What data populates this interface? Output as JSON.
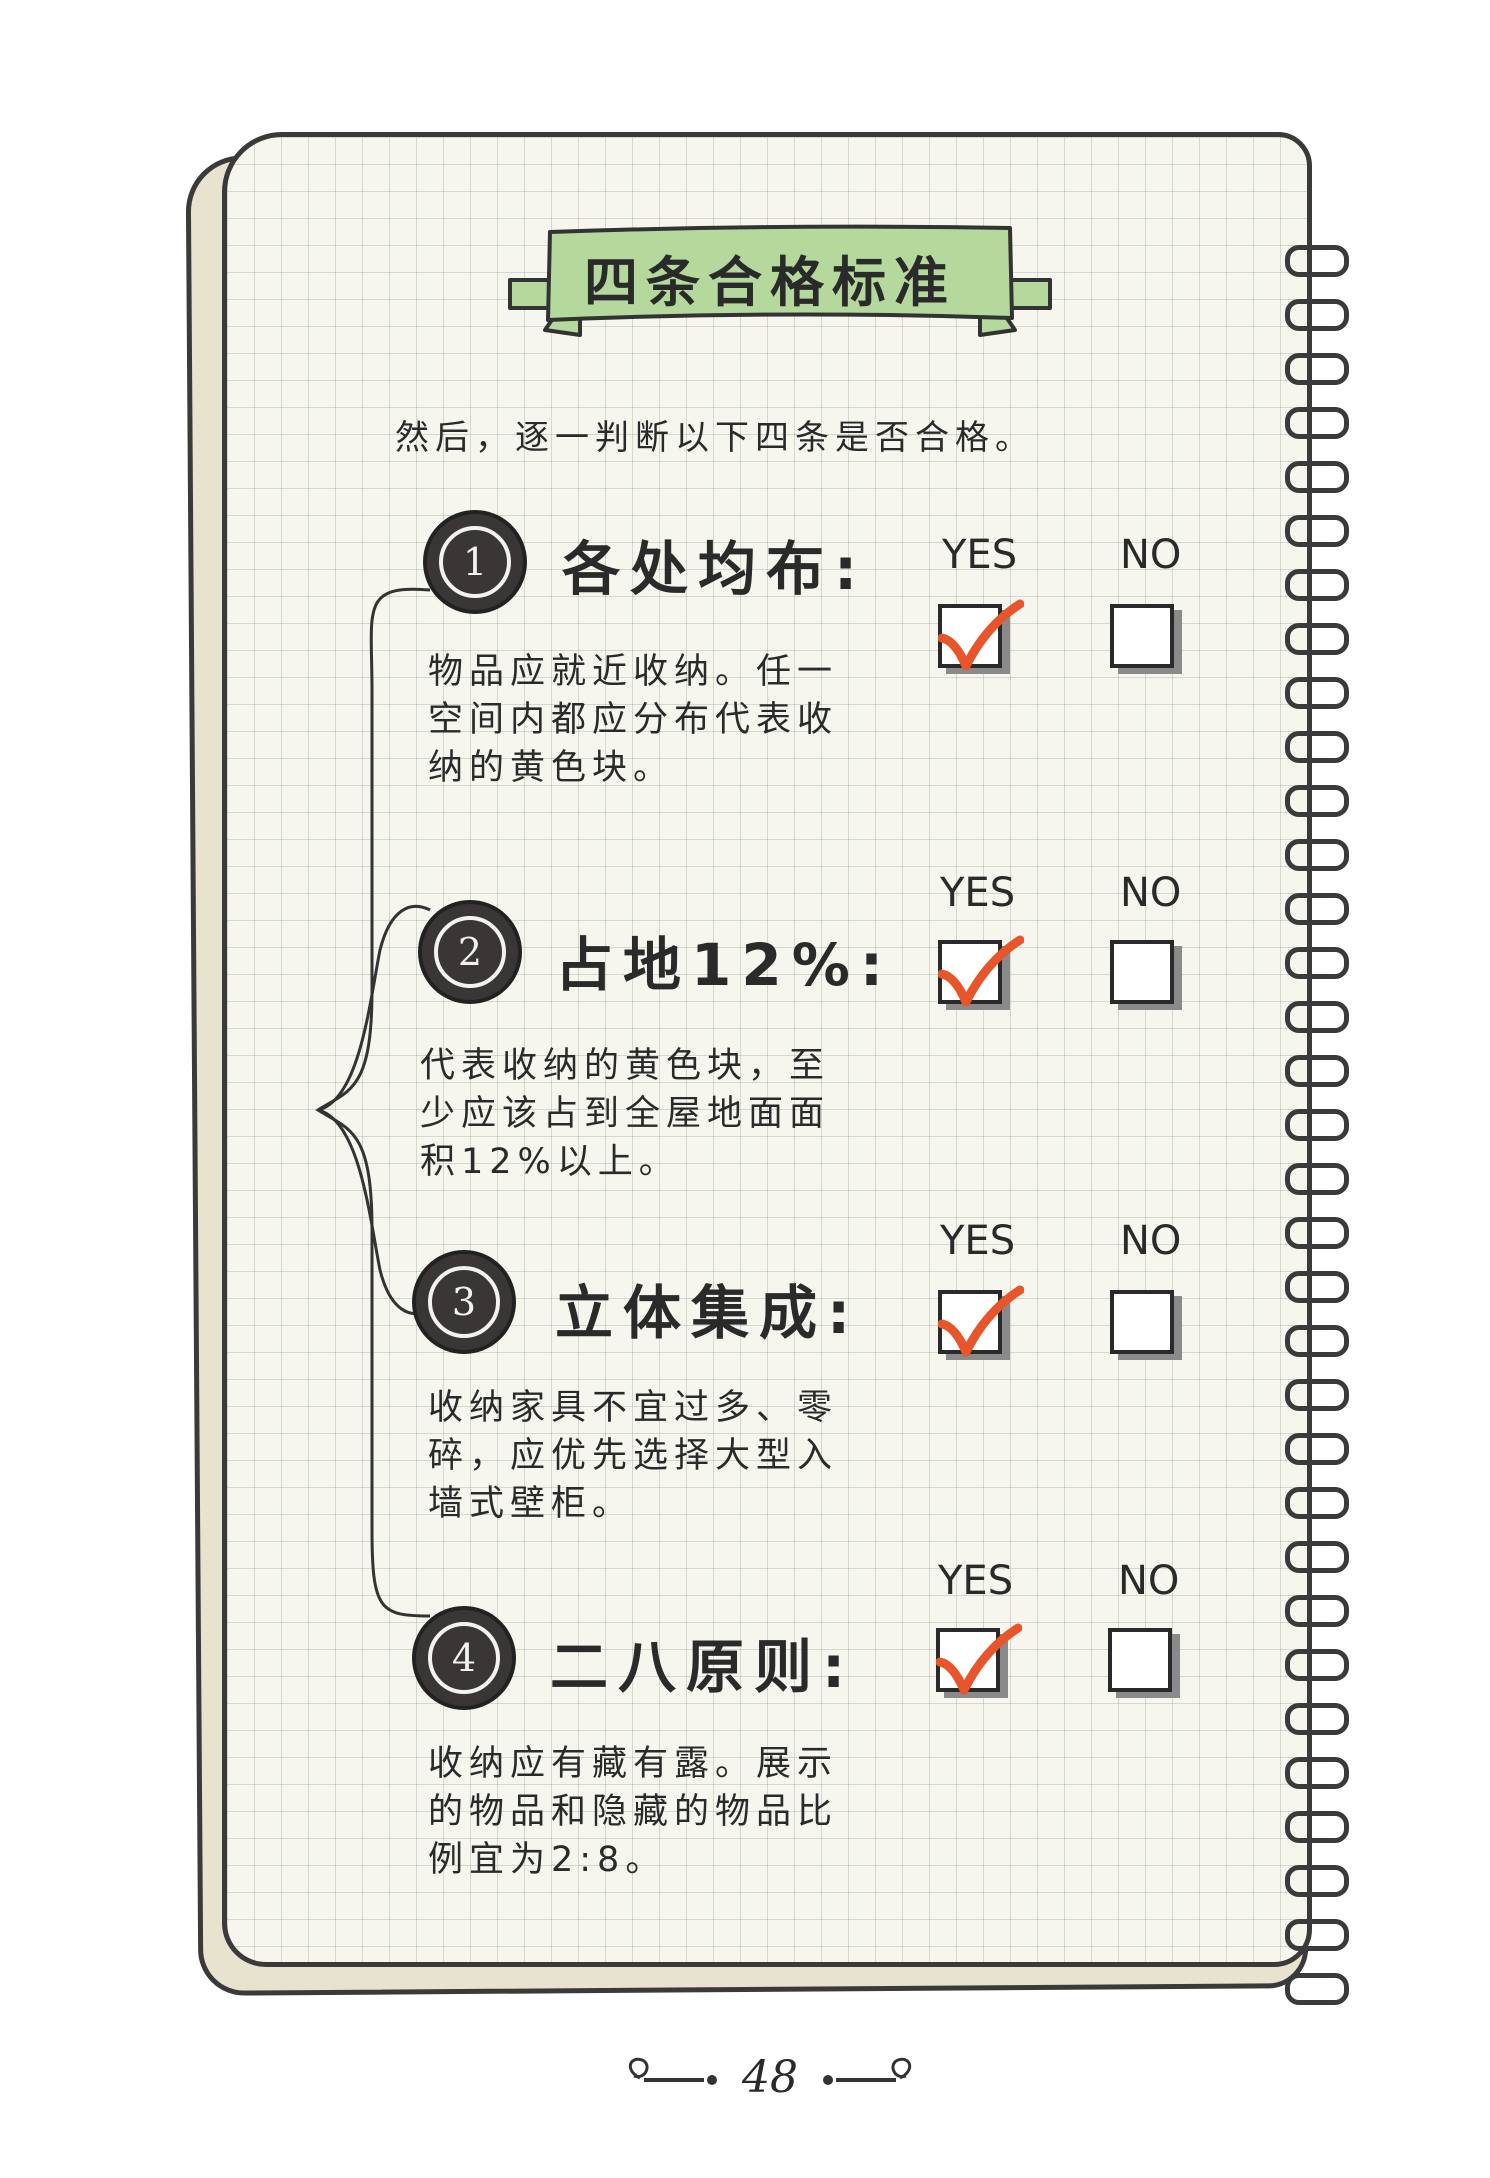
{
  "title": "四条合格标准",
  "intro": "然后，逐一判断以下四条是否合格。",
  "options": {
    "yes": "YES",
    "no": "NO"
  },
  "criteria": [
    {
      "number": "1",
      "heading": "各处均布:",
      "description": "物品应就近收纳。任一空间内都应分布代表收纳的黄色块。",
      "yes_checked": true,
      "no_checked": false
    },
    {
      "number": "2",
      "heading": "占地12%:",
      "description": "代表收纳的黄色块，至少应该占到全屋地面面积12%以上。",
      "yes_checked": true,
      "no_checked": false
    },
    {
      "number": "3",
      "heading": "立体集成:",
      "description": "收纳家具不宜过多、零碎，应优先选择大型入墙式壁柜。",
      "yes_checked": true,
      "no_checked": false
    },
    {
      "number": "4",
      "heading": "二八原则:",
      "description": "收纳应有藏有露。展示的物品和隐藏的物品比例宜为2:8。",
      "yes_checked": true,
      "no_checked": false
    }
  ],
  "page_number": "48",
  "colors": {
    "banner": "#b5d89c",
    "check": "#e8552a",
    "badge": "#3a3635",
    "grid": "#8c9c8c"
  }
}
